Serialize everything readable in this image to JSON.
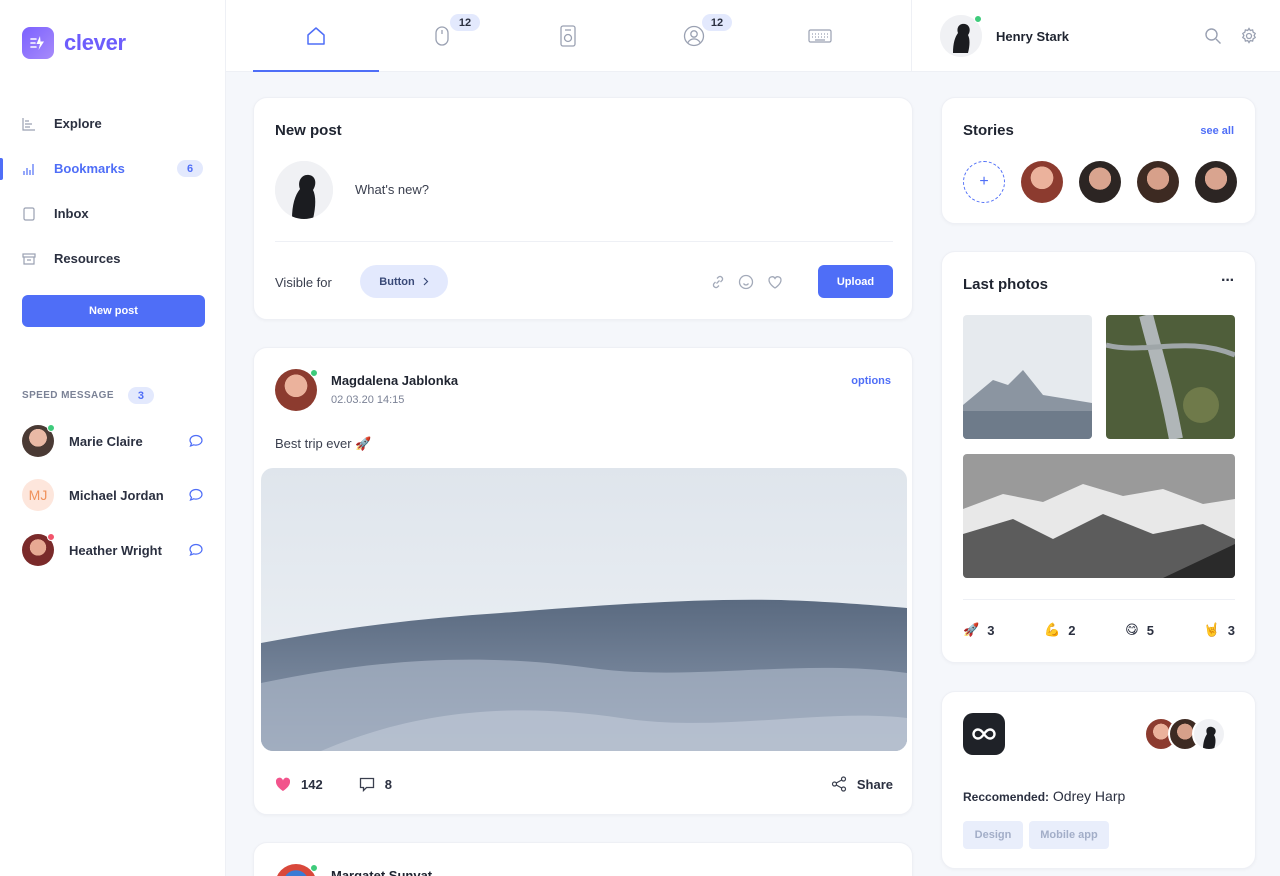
{
  "app": {
    "name": "clever"
  },
  "sidebar": {
    "nav": [
      {
        "label": "Explore",
        "icon": "explore-icon"
      },
      {
        "label": "Bookmarks",
        "icon": "bar-chart-icon",
        "badge": "6",
        "active": true
      },
      {
        "label": "Inbox",
        "icon": "inbox-icon"
      },
      {
        "label": "Resources",
        "icon": "archive-icon"
      }
    ],
    "new_post_label": "New post",
    "speed_message": {
      "title": "SPEED MESSAGE",
      "count": "3",
      "contacts": [
        {
          "name": "Marie Claire",
          "status": "online"
        },
        {
          "name": "Michael Jordan",
          "initials": "MJ"
        },
        {
          "name": "Heather Wright",
          "status": "busy"
        }
      ]
    }
  },
  "topbar": {
    "tabs": [
      {
        "icon": "home-icon",
        "active": true
      },
      {
        "icon": "mouse-icon",
        "badge": "12"
      },
      {
        "icon": "speaker-icon"
      },
      {
        "icon": "user-circle-icon",
        "badge": "12"
      },
      {
        "icon": "keyboard-icon"
      }
    ],
    "user": {
      "name": "Henry Stark"
    }
  },
  "new_post": {
    "title": "New post",
    "placeholder": "What's new?",
    "visible_label": "Visible for",
    "visibility_button": "Button",
    "upload_label": "Upload"
  },
  "post": {
    "author": "Magdalena Jablonka",
    "date": "02.03.20 14:15",
    "options_label": "options",
    "text": "Best trip ever 🚀",
    "likes": "142",
    "comments": "8",
    "share_label": "Share"
  },
  "next_post": {
    "author": "Margatet Sunvat"
  },
  "stories": {
    "title": "Stories",
    "see_all": "see all"
  },
  "last_photos": {
    "title": "Last photos",
    "menu": "···",
    "reactions": [
      {
        "emoji": "🚀",
        "count": "3"
      },
      {
        "emoji": "💪",
        "count": "2"
      },
      {
        "emoji": "😋",
        "count": "5"
      },
      {
        "emoji": "🤘",
        "count": "3"
      }
    ]
  },
  "recommended": {
    "label": "Reccomended:",
    "name": "Odrey Harp",
    "tags": [
      "Design",
      "Mobile app"
    ]
  },
  "colors": {
    "accent": "#4f6ef7",
    "brand": "#6d5dfc",
    "like": "#f2548c",
    "online": "#3ecb7b",
    "busy": "#f2546b"
  }
}
